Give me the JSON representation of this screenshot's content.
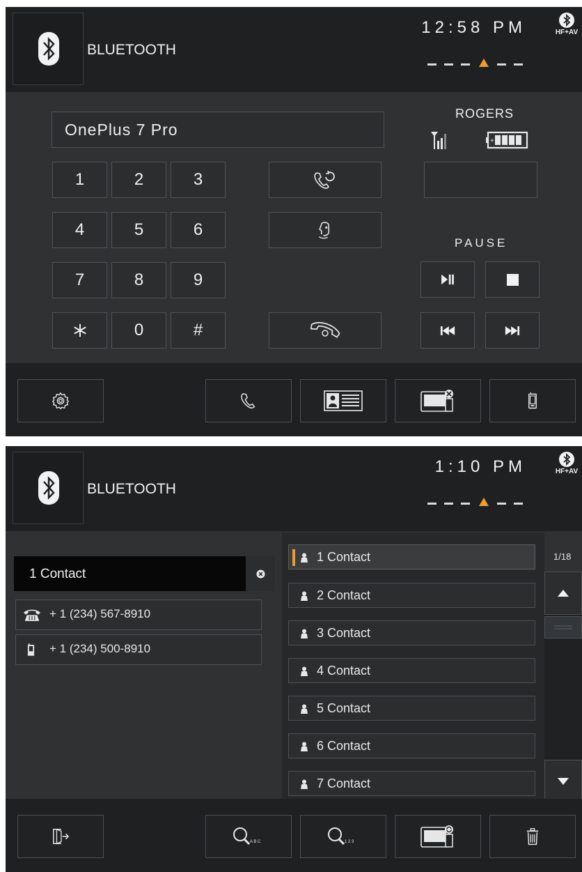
{
  "screen1": {
    "header": {
      "title": "BLUETOOTH",
      "time": "12:58 PM",
      "bt_badge": "HF+AV"
    },
    "device_name": "OnePlus 7 Pro",
    "keypad": [
      "1",
      "2",
      "3",
      "4",
      "5",
      "6",
      "7",
      "8",
      "9",
      "*",
      "0",
      "#"
    ],
    "carrier": "ROGERS",
    "playback_status": "PAUSE",
    "media_buttons": [
      "play-pause-icon",
      "stop-icon",
      "previous-track-icon",
      "next-track-icon"
    ],
    "call_buttons": [
      "redial-icon",
      "voice-assistant-icon",
      "hang-up-icon"
    ],
    "footer": [
      "settings-icon",
      "phone-icon",
      "contacts-icon",
      "delete-device-icon",
      "mobile-device-icon"
    ],
    "accent_color": "#f19b2a"
  },
  "screen2": {
    "header": {
      "title": "BLUETOOTH",
      "time": "1:10 PM",
      "bt_badge": "HF+AV"
    },
    "search_value": "1 Contact",
    "phones": [
      {
        "type": "home-phone-icon",
        "number": "+ 1 (234) 567-8910"
      },
      {
        "type": "mobile-phone-icon",
        "number": "+ 1 (234) 500-8910"
      }
    ],
    "contacts": [
      "1 Contact",
      "2 Contact",
      "3 Contact",
      "4 Contact",
      "5 Contact",
      "6 Contact",
      "7 Contact"
    ],
    "selected_contact": "1 Contact",
    "page_indicator": "1/18",
    "footer": [
      "exit-icon",
      "search-abc-icon",
      "search-123-icon",
      "sync-phonebook-icon",
      "trash-icon"
    ]
  }
}
